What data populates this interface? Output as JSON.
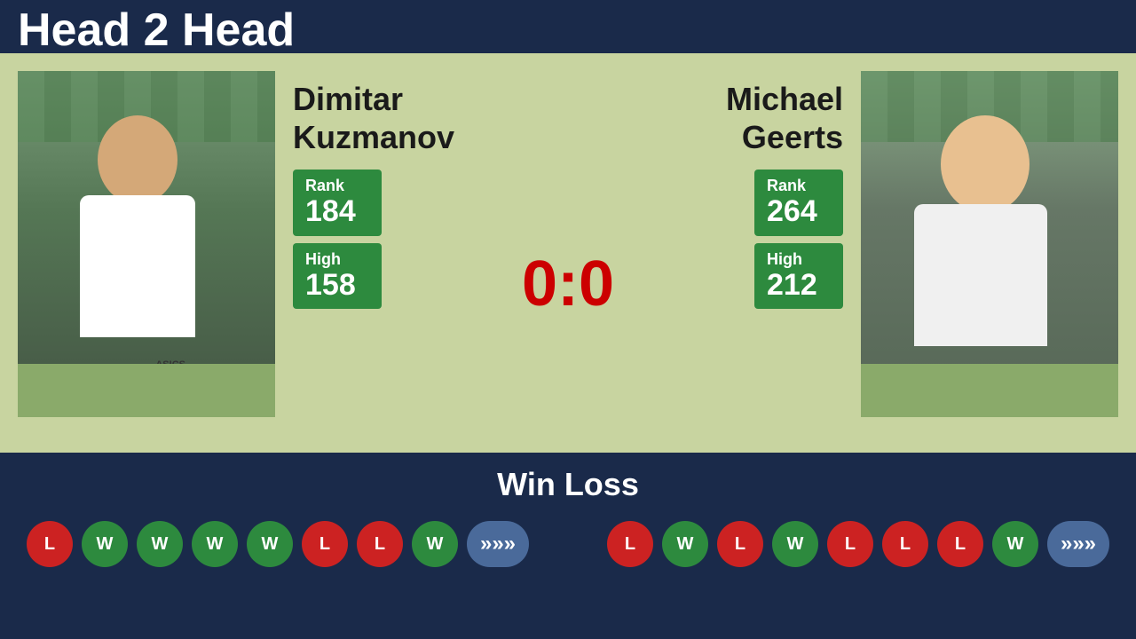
{
  "header": {
    "title": "Head 2 Head"
  },
  "player1": {
    "name_line1": "Dimitar",
    "name_line2": "Kuzmanov",
    "rank_label": "Rank",
    "rank_value": "184",
    "high_label": "High",
    "high_value": "158"
  },
  "player2": {
    "name_line1": "Michael",
    "name_line2": "Geerts",
    "rank_label": "Rank",
    "rank_value": "264",
    "high_label": "High",
    "high_value": "212"
  },
  "score": {
    "display": "0:0"
  },
  "bottom": {
    "section_title": "Win Loss",
    "more_symbol": "»»»",
    "player1_results": [
      "L",
      "W",
      "W",
      "W",
      "W",
      "L",
      "L",
      "W"
    ],
    "player2_results": [
      "L",
      "W",
      "L",
      "W",
      "L",
      "L",
      "L",
      "W"
    ]
  }
}
